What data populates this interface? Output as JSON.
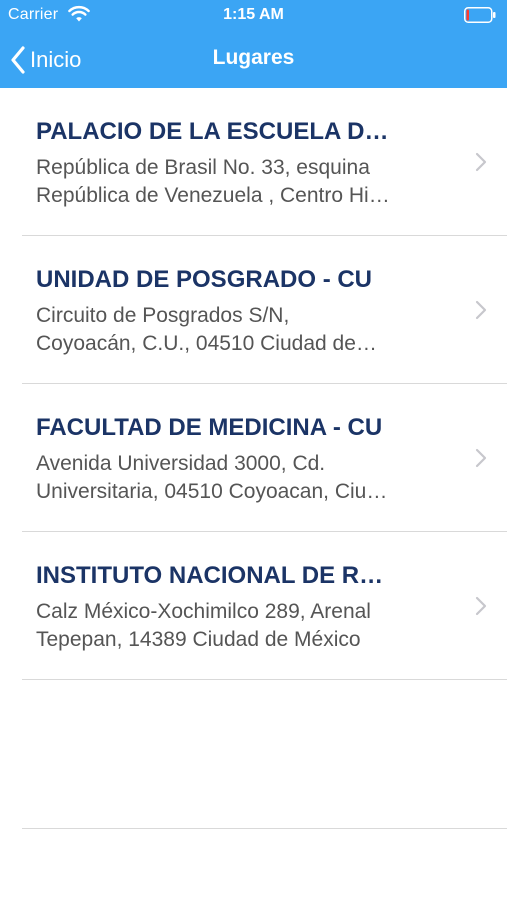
{
  "status_bar": {
    "carrier": "Carrier",
    "time": "1:15 AM",
    "battery_level": 0.05,
    "battery_color": "#ff3b30"
  },
  "nav": {
    "back_label": "Inicio",
    "title": "Lugares",
    "background": "#3ba5f4"
  },
  "places": [
    {
      "name": "PALACIO DE LA ESCUELA D…",
      "address_line1": "República de Brasil No. 33, esquina",
      "address_line2": "República de Venezuela , Centro Hi…"
    },
    {
      "name": "UNIDAD DE POSGRADO - CU",
      "address_line1": "Circuito de Posgrados S/N,",
      "address_line2": "Coyoacán, C.U., 04510 Ciudad de…"
    },
    {
      "name": "FACULTAD DE MEDICINA - CU",
      "address_line1": "Avenida Universidad 3000, Cd.",
      "address_line2": "Universitaria, 04510 Coyoacan, Ciu…"
    },
    {
      "name": "INSTITUTO NACIONAL DE R…",
      "address_line1": "Calz México-Xochimilco 289, Arenal",
      "address_line2": "Tepepan, 14389 Ciudad de México"
    }
  ],
  "colors": {
    "title_text": "#1b3466",
    "address_text": "#555555",
    "separator": "#d9d9d9",
    "chevron": "#c7c7cc"
  },
  "icons": {
    "wifi": "wifi-icon",
    "battery": "battery-icon",
    "back": "chevron-left-icon",
    "disclosure": "chevron-right-icon"
  }
}
